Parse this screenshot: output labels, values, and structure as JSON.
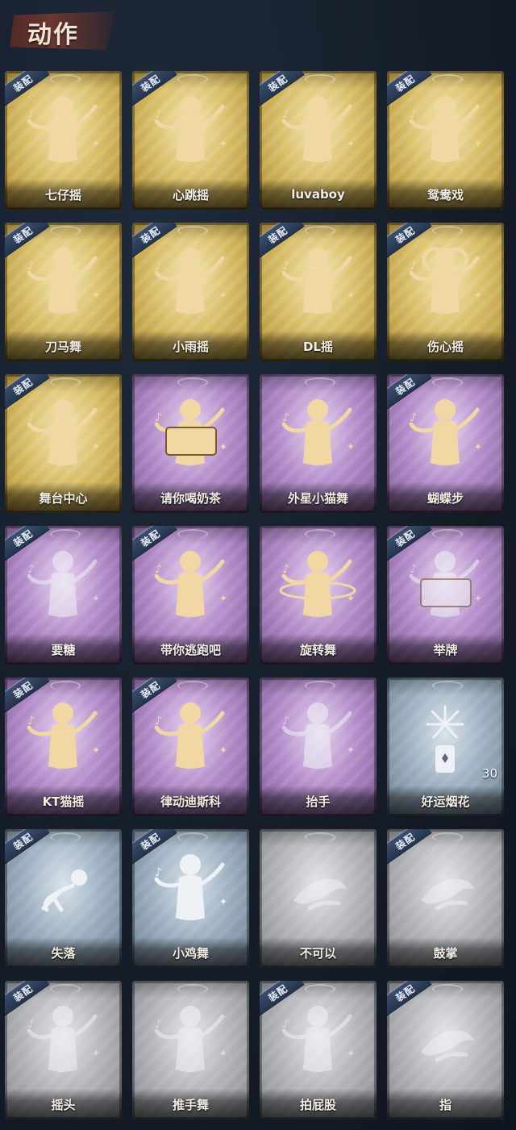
{
  "header": {
    "title": "动作"
  },
  "equip_label": "装配",
  "cards": [
    {
      "label": "七仔摇",
      "tier": "gold",
      "equipped": true,
      "icon": "dance-figure-icon"
    },
    {
      "label": "心跳摇",
      "tier": "gold",
      "equipped": true,
      "icon": "dance-figure-icon"
    },
    {
      "label": "luvaboy",
      "tier": "gold",
      "equipped": true,
      "icon": "dance-figure-icon"
    },
    {
      "label": "鸳鸯戏",
      "tier": "gold",
      "equipped": true,
      "icon": "dance-figure-icon"
    },
    {
      "label": "刀马舞",
      "tier": "gold",
      "equipped": true,
      "icon": "dance-figure-icon"
    },
    {
      "label": "小雨摇",
      "tier": "gold",
      "equipped": true,
      "icon": "dance-figure-icon"
    },
    {
      "label": "DL摇",
      "tier": "gold",
      "equipped": true,
      "icon": "dance-figure-icon"
    },
    {
      "label": "伤心摇",
      "tier": "gold",
      "equipped": true,
      "icon": "heart-hands-figure-icon"
    },
    {
      "label": "舞台中心",
      "tier": "gold",
      "equipped": true,
      "icon": "dance-figure-icon"
    },
    {
      "label": "请你喝奶茶",
      "tier": "purple",
      "equipped": false,
      "icon": "sign-figure-icon"
    },
    {
      "label": "外星小猫舞",
      "tier": "purple",
      "equipped": false,
      "icon": "dance-figure-icon"
    },
    {
      "label": "蝴蝶步",
      "tier": "purple",
      "equipped": true,
      "icon": "dance-figure-icon"
    },
    {
      "label": "要糖",
      "tier": "purple",
      "equipped": true,
      "icon": "reach-figure-icon",
      "dim": true
    },
    {
      "label": "带你逃跑吧",
      "tier": "purple",
      "equipped": true,
      "icon": "dance-figure-icon"
    },
    {
      "label": "旋转舞",
      "tier": "purple",
      "equipped": false,
      "icon": "spin-figure-icon"
    },
    {
      "label": "举牌",
      "tier": "purple",
      "equipped": true,
      "icon": "sign-figure-icon",
      "dim": true
    },
    {
      "label": "KT猫摇",
      "tier": "purple",
      "equipped": true,
      "icon": "dance-figure-icon"
    },
    {
      "label": "律动迪斯科",
      "tier": "purple",
      "equipped": true,
      "icon": "disco-figure-icon"
    },
    {
      "label": "抬手",
      "tier": "purple",
      "equipped": false,
      "icon": "raise-hand-figure-icon",
      "dim": true
    },
    {
      "label": "好运烟花",
      "tier": "blue",
      "equipped": false,
      "icon": "firework-icon",
      "count": "30"
    },
    {
      "label": "失落",
      "tier": "blue",
      "equipped": true,
      "icon": "crawl-figure-icon"
    },
    {
      "label": "小鸡舞",
      "tier": "blue",
      "equipped": true,
      "icon": "chicken-dance-figure-icon"
    },
    {
      "label": "不可以",
      "tier": "gray",
      "equipped": false,
      "icon": "finger-wag-icon",
      "dim": true
    },
    {
      "label": "鼓掌",
      "tier": "gray",
      "equipped": true,
      "icon": "clap-hands-icon",
      "dim": true
    },
    {
      "label": "摇头",
      "tier": "gray",
      "equipped": true,
      "icon": "shake-head-figure-icon",
      "dim": true
    },
    {
      "label": "推手舞",
      "tier": "gray",
      "equipped": false,
      "icon": "push-hand-figure-icon",
      "dim": true
    },
    {
      "label": "拍屁股",
      "tier": "gray",
      "equipped": true,
      "icon": "butt-slap-figure-icon",
      "dim": true
    },
    {
      "label": "指",
      "tier": "gray",
      "equipped": true,
      "icon": "point-hand-icon",
      "dim": true
    }
  ],
  "colors": {
    "gold_figure": "#f1d7a4",
    "silver_figure": "#eef1f5",
    "equip_tag": "#2e405c"
  }
}
